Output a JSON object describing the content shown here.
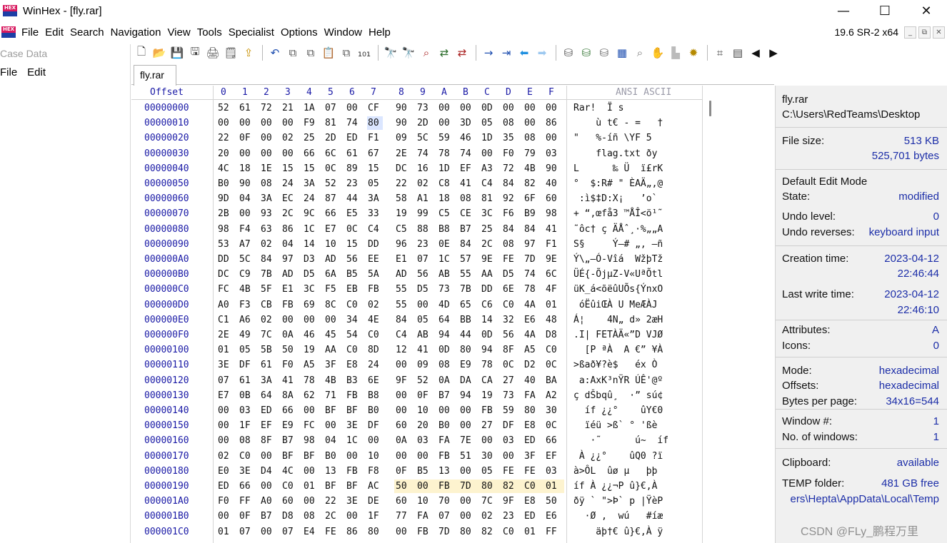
{
  "window": {
    "title": "WinHex - [fly.rar]",
    "logo_text": "HEX",
    "controls": {
      "minimize": "—",
      "maximize": "☐",
      "close": "✕"
    }
  },
  "menu": {
    "items": [
      "File",
      "Edit",
      "Search",
      "Navigation",
      "View",
      "Tools",
      "Specialist",
      "Options",
      "Window",
      "Help"
    ],
    "version": "19.6 SR-2 x64",
    "mdi_buttons": [
      "_",
      "⧉",
      "✕"
    ]
  },
  "toolbar": {
    "groups": [
      [
        {
          "icon": "new-file-icon",
          "glyph": "🗋",
          "color": "#333333"
        },
        {
          "icon": "open-folder-icon",
          "glyph": "📂",
          "color": "#e0a800"
        },
        {
          "icon": "save-icon",
          "glyph": "💾",
          "color": "#2b2b2b"
        },
        {
          "icon": "save-all-icon",
          "glyph": "🖫",
          "color": "#444444"
        },
        {
          "icon": "print-icon",
          "glyph": "🖨",
          "color": "#555555"
        },
        {
          "icon": "properties-icon",
          "glyph": "🗒",
          "color": "#444444"
        },
        {
          "icon": "export-icon",
          "glyph": "⇪",
          "color": "#c78f00"
        }
      ],
      [
        {
          "icon": "undo-icon",
          "glyph": "↶",
          "color": "#1f4fb0"
        },
        {
          "icon": "copy-icon",
          "glyph": "⧉",
          "color": "#555555"
        },
        {
          "icon": "cut-icon",
          "glyph": "⧉",
          "color": "#555555"
        },
        {
          "icon": "paste-icon",
          "glyph": "📋",
          "color": "#555555"
        },
        {
          "icon": "copy-block-icon",
          "glyph": "⧉",
          "color": "#555555"
        },
        {
          "icon": "binary-icon",
          "glyph": "₁₀₁",
          "color": "#333333"
        }
      ],
      [
        {
          "icon": "find-text-icon",
          "glyph": "🔭",
          "color": "#333333"
        },
        {
          "icon": "find-hex-icon",
          "glyph": "🔭",
          "color": "#8a2be2"
        },
        {
          "icon": "find-hex-values-icon",
          "glyph": "⌕",
          "color": "#aa2222"
        },
        {
          "icon": "replace-text-icon",
          "glyph": "⇄",
          "color": "#2a6c2a"
        },
        {
          "icon": "replace-hex-icon",
          "glyph": "⇄",
          "color": "#aa2222"
        }
      ],
      [
        {
          "icon": "goto-offset-icon",
          "glyph": "→",
          "color": "#1f4fb0"
        },
        {
          "icon": "goto-page-icon",
          "glyph": "⇥",
          "color": "#1f4fb0"
        },
        {
          "icon": "back-icon",
          "glyph": "⬅",
          "color": "#1e8fe0"
        },
        {
          "icon": "forward-icon",
          "glyph": "➡",
          "color": "#9cc8f0"
        }
      ],
      [
        {
          "icon": "disk-icon",
          "glyph": "⛁",
          "color": "#555555"
        },
        {
          "icon": "disk-edit-icon",
          "glyph": "⛁",
          "color": "#3a7a3a"
        },
        {
          "icon": "image-disk-icon",
          "glyph": "⛁",
          "color": "#666666"
        },
        {
          "icon": "ram-icon",
          "glyph": "▦",
          "color": "#1f4fb0"
        },
        {
          "icon": "zoom-icon",
          "glyph": "⌕",
          "color": "#777777"
        },
        {
          "icon": "hand-icon",
          "glyph": "✋",
          "color": "#aaaaaa"
        },
        {
          "icon": "chart-icon",
          "glyph": "▙",
          "color": "#bbbbbb"
        },
        {
          "icon": "settings-icon",
          "glyph": "✹",
          "color": "#b58900"
        }
      ],
      [
        {
          "icon": "calculator-icon",
          "glyph": "⌗",
          "color": "#444444"
        },
        {
          "icon": "table-icon",
          "glyph": "▤",
          "color": "#444444"
        },
        {
          "icon": "prev-icon",
          "glyph": "◀",
          "color": "#111111"
        },
        {
          "icon": "next-icon",
          "glyph": "▶",
          "color": "#111111"
        }
      ]
    ]
  },
  "left_panel": {
    "title": "Case Data",
    "menu": [
      "File",
      "Edit"
    ]
  },
  "tab": {
    "label": "fly.rar"
  },
  "hex_view": {
    "header": {
      "offset": "Offset",
      "columns": [
        "0",
        "1",
        "2",
        "3",
        "4",
        "5",
        "6",
        "7",
        "8",
        "9",
        "A",
        "B",
        "C",
        "D",
        "E",
        "F"
      ],
      "ascii": "ANSI ASCII"
    },
    "selected_cell": {
      "row": 1,
      "col": 7
    },
    "highlight": {
      "row": 25,
      "from_col": 8,
      "to_col": 15
    },
    "rows": [
      {
        "offset": "00000000",
        "bytes": [
          "52",
          "61",
          "72",
          "21",
          "1A",
          "07",
          "00",
          "CF",
          "90",
          "73",
          "00",
          "00",
          "0D",
          "00",
          "00",
          "00"
        ],
        "ascii": "Rar!  Ï s"
      },
      {
        "offset": "00000010",
        "bytes": [
          "00",
          "00",
          "00",
          "00",
          "F9",
          "81",
          "74",
          "80",
          "90",
          "2D",
          "00",
          "3D",
          "05",
          "08",
          "00",
          "86"
        ],
        "ascii": "    ù t€ - =   †"
      },
      {
        "offset": "00000020",
        "bytes": [
          "22",
          "0F",
          "00",
          "02",
          "25",
          "2D",
          "ED",
          "F1",
          "09",
          "5C",
          "59",
          "46",
          "1D",
          "35",
          "08",
          "00"
        ],
        "ascii": "\"   %-íñ \\YF 5"
      },
      {
        "offset": "00000030",
        "bytes": [
          "20",
          "00",
          "00",
          "00",
          "66",
          "6C",
          "61",
          "67",
          "2E",
          "74",
          "78",
          "74",
          "00",
          "F0",
          "79",
          "03"
        ],
        "ascii": "    flag.txt ðy"
      },
      {
        "offset": "00000040",
        "bytes": [
          "4C",
          "18",
          "1E",
          "15",
          "15",
          "0C",
          "89",
          "15",
          "DC",
          "16",
          "1D",
          "EF",
          "A3",
          "72",
          "4B",
          "90"
        ],
        "ascii": "L      ‰ Ü  ï£rK"
      },
      {
        "offset": "00000050",
        "bytes": [
          "B0",
          "90",
          "08",
          "24",
          "3A",
          "52",
          "23",
          "05",
          "22",
          "02",
          "C8",
          "41",
          "C4",
          "84",
          "82",
          "40"
        ],
        "ascii": "°  $:R# \" ÈAÄ„‚@"
      },
      {
        "offset": "00000060",
        "bytes": [
          "9D",
          "04",
          "3A",
          "EC",
          "24",
          "87",
          "44",
          "3A",
          "58",
          "A1",
          "18",
          "08",
          "81",
          "92",
          "6F",
          "60"
        ],
        "ascii": " :ì$‡D:X¡   ’o`"
      },
      {
        "offset": "00000070",
        "bytes": [
          "2B",
          "00",
          "93",
          "2C",
          "9C",
          "66",
          "E5",
          "33",
          "19",
          "99",
          "C5",
          "CE",
          "3C",
          "F6",
          "B9",
          "98"
        ],
        "ascii": "+ “,œfå3 ™ÅÎ<ö¹˜"
      },
      {
        "offset": "00000080",
        "bytes": [
          "98",
          "F4",
          "63",
          "86",
          "1C",
          "E7",
          "0C",
          "C4",
          "C5",
          "88",
          "B8",
          "B7",
          "25",
          "84",
          "84",
          "41"
        ],
        "ascii": "˜ôc† ç ÄÅˆ¸·%„„A"
      },
      {
        "offset": "00000090",
        "bytes": [
          "53",
          "A7",
          "02",
          "04",
          "14",
          "10",
          "15",
          "DD",
          "96",
          "23",
          "0E",
          "84",
          "2C",
          "08",
          "97",
          "F1"
        ],
        "ascii": "S§     Ý–# „, —ñ"
      },
      {
        "offset": "000000A0",
        "bytes": [
          "DD",
          "5C",
          "84",
          "97",
          "D3",
          "AD",
          "56",
          "EE",
          "E1",
          "07",
          "1C",
          "57",
          "9E",
          "FE",
          "7D",
          "9E"
        ],
        "ascii": "Ý\\„—Ó-Vîá  WžþTž"
      },
      {
        "offset": "000000B0",
        "bytes": [
          "DC",
          "C9",
          "7B",
          "AD",
          "D5",
          "6A",
          "B5",
          "5A",
          "AD",
          "56",
          "AB",
          "55",
          "AA",
          "D5",
          "74",
          "6C"
        ],
        "ascii": "ÜÉ{-ÕjµZ-V«UªÕtl"
      },
      {
        "offset": "000000C0",
        "bytes": [
          "FC",
          "4B",
          "5F",
          "E1",
          "3C",
          "F5",
          "EB",
          "FB",
          "55",
          "D5",
          "73",
          "7B",
          "DD",
          "6E",
          "78",
          "4F"
        ],
        "ascii": "üK_á<õëûUÕs{ÝnxO"
      },
      {
        "offset": "000000D0",
        "bytes": [
          "A0",
          "F3",
          "CB",
          "FB",
          "69",
          "8C",
          "C0",
          "02",
          "55",
          "00",
          "4D",
          "65",
          "C6",
          "C0",
          "4A",
          "01"
        ],
        "ascii": " óËûiŒÀ U MeÆÀJ"
      },
      {
        "offset": "000000E0",
        "bytes": [
          "C1",
          "A6",
          "02",
          "00",
          "00",
          "00",
          "34",
          "4E",
          "84",
          "05",
          "64",
          "BB",
          "14",
          "32",
          "E6",
          "48"
        ],
        "ascii": "Á¦    4N„ d» 2æH"
      },
      {
        "offset": "000000F0",
        "bytes": [
          "2E",
          "49",
          "7C",
          "0A",
          "46",
          "45",
          "54",
          "C0",
          "C4",
          "AB",
          "94",
          "44",
          "0D",
          "56",
          "4A",
          "D8"
        ],
        "ascii": ".I| FETÀÄ«”D VJØ"
      },
      {
        "offset": "00000100",
        "bytes": [
          "01",
          "05",
          "5B",
          "50",
          "19",
          "AA",
          "C0",
          "8D",
          "12",
          "41",
          "0D",
          "80",
          "94",
          "8F",
          "A5",
          "C0"
        ],
        "ascii": "  [P ªÀ  A €” ¥À"
      },
      {
        "offset": "00000110",
        "bytes": [
          "3E",
          "DF",
          "61",
          "F0",
          "A5",
          "3F",
          "E8",
          "24",
          "00",
          "09",
          "08",
          "E9",
          "78",
          "0C",
          "D2",
          "0C"
        ],
        "ascii": ">ßað¥?è$   éx Ò"
      },
      {
        "offset": "00000120",
        "bytes": [
          "07",
          "61",
          "3A",
          "41",
          "78",
          "4B",
          "B3",
          "6E",
          "9F",
          "52",
          "0A",
          "DA",
          "CA",
          "27",
          "40",
          "BA"
        ],
        "ascii": " a:AxK³nŸR ÚÊ'@º"
      },
      {
        "offset": "00000130",
        "bytes": [
          "E7",
          "0B",
          "64",
          "8A",
          "62",
          "71",
          "FB",
          "B8",
          "00",
          "0F",
          "B7",
          "94",
          "19",
          "73",
          "FA",
          "A2"
        ],
        "ascii": "ç dŠbqû¸  ·” sú¢"
      },
      {
        "offset": "00000140",
        "bytes": [
          "00",
          "03",
          "ED",
          "66",
          "00",
          "BF",
          "BF",
          "B0",
          "00",
          "10",
          "00",
          "00",
          "FB",
          "59",
          "80",
          "30"
        ],
        "ascii": "  íf ¿¿°    ûY€0"
      },
      {
        "offset": "00000150",
        "bytes": [
          "00",
          "1F",
          "EF",
          "E9",
          "FC",
          "00",
          "3E",
          "DF",
          "60",
          "20",
          "B0",
          "00",
          "27",
          "DF",
          "E8",
          "0C"
        ],
        "ascii": "  ïéü >ß` ° 'ßè"
      },
      {
        "offset": "00000160",
        "bytes": [
          "00",
          "08",
          "8F",
          "B7",
          "98",
          "04",
          "1C",
          "00",
          "0A",
          "03",
          "FA",
          "7E",
          "00",
          "03",
          "ED",
          "66"
        ],
        "ascii": "   ·˜      ú~  íf"
      },
      {
        "offset": "00000170",
        "bytes": [
          "02",
          "C0",
          "00",
          "BF",
          "BF",
          "B0",
          "00",
          "10",
          "00",
          "00",
          "FB",
          "51",
          "30",
          "00",
          "3F",
          "EF"
        ],
        "ascii": " À ¿¿°    ûQ0 ?ï"
      },
      {
        "offset": "00000180",
        "bytes": [
          "E0",
          "3E",
          "D4",
          "4C",
          "00",
          "13",
          "FB",
          "F8",
          "0F",
          "B5",
          "13",
          "00",
          "05",
          "FE",
          "FE",
          "03"
        ],
        "ascii": "à>ÔL  ûø µ   þþ"
      },
      {
        "offset": "00000190",
        "bytes": [
          "ED",
          "66",
          "00",
          "C0",
          "01",
          "BF",
          "BF",
          "AC",
          "50",
          "00",
          "FB",
          "7D",
          "80",
          "82",
          "C0",
          "01"
        ],
        "ascii": "íf À ¿¿¬P û}€‚À"
      },
      {
        "offset": "000001A0",
        "bytes": [
          "F0",
          "FF",
          "A0",
          "60",
          "00",
          "22",
          "3E",
          "DE",
          "60",
          "10",
          "70",
          "00",
          "7C",
          "9F",
          "E8",
          "50"
        ],
        "ascii": "ðÿ ` \">Þ` p |ŸèP"
      },
      {
        "offset": "000001B0",
        "bytes": [
          "00",
          "0F",
          "B7",
          "D8",
          "08",
          "2C",
          "00",
          "1F",
          "77",
          "FA",
          "07",
          "00",
          "02",
          "23",
          "ED",
          "E6"
        ],
        "ascii": "  ·Ø ,  wú   #íæ"
      },
      {
        "offset": "000001C0",
        "bytes": [
          "01",
          "07",
          "00",
          "07",
          "E4",
          "FE",
          "86",
          "80",
          "00",
          "FB",
          "7D",
          "80",
          "82",
          "C0",
          "01",
          "FF"
        ],
        "ascii": "    äþ†€ û}€‚À ÿ"
      }
    ]
  },
  "info_panel": {
    "file_name": "fly.rar",
    "path": "C:\\Users\\RedTeams\\Desktop",
    "file_size_label": "File size:",
    "file_size_kb": "513 KB",
    "file_size_bytes": "525,701 bytes",
    "edit_mode": "Default Edit Mode",
    "state_label": "State:",
    "state_value": "modified",
    "undo_level_label": "Undo level:",
    "undo_level_value": "0",
    "undo_reverses_label": "Undo reverses:",
    "undo_reverses_value": "keyboard input",
    "creation_label": "Creation time:",
    "creation_date": "2023-04-12",
    "creation_time": "22:46:44",
    "last_write_label": "Last write time:",
    "last_write_date": "2023-04-12",
    "last_write_time": "22:46:10",
    "attributes_label": "Attributes:",
    "attributes_value": "A",
    "icons_label": "Icons:",
    "icons_value": "0",
    "mode_label": "Mode:",
    "mode_value": "hexadecimal",
    "offsets_label": "Offsets:",
    "offsets_value": "hexadecimal",
    "bpp_label": "Bytes per page:",
    "bpp_value": "34x16=544",
    "window_no_label": "Window #:",
    "window_no_value": "1",
    "num_windows_label": "No. of windows:",
    "num_windows_value": "1",
    "clipboard_label": "Clipboard:",
    "clipboard_value": "available",
    "temp_label": "TEMP folder:",
    "temp_value": "481 GB free",
    "temp_path": "ers\\Hepta\\AppData\\Local\\Temp"
  },
  "watermark": "CSDN @FLy_鹏程万里",
  "colors": {
    "offset_blue": "#1a1aa6",
    "info_value_blue": "#1c2ea8",
    "highlight_bg": "#fdf3cf",
    "selection_bg": "#dbe6ff",
    "info_bg": "#f0f0f0"
  }
}
